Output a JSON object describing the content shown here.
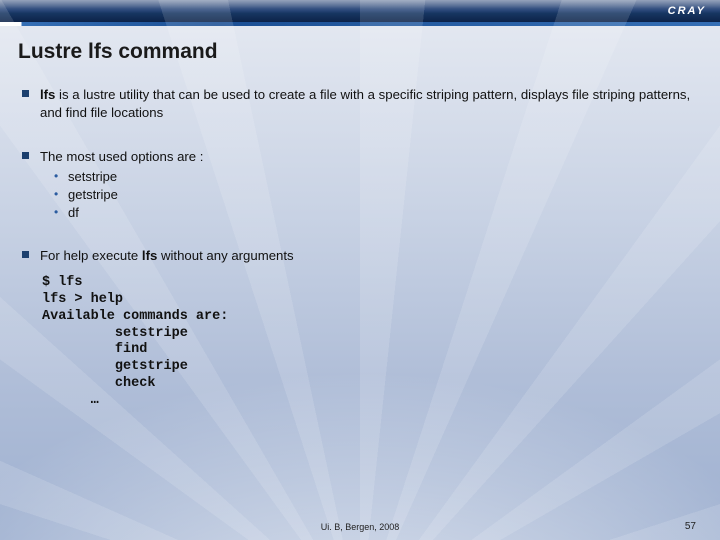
{
  "brand": "CRAY",
  "title": "Lustre lfs command",
  "bullets": {
    "b1_strong": "lfs",
    "b1_rest": " is a lustre utility that can be used to create a file with a specific striping pattern, displays file striping patterns, and find file locations",
    "b2": "The most used options are :",
    "b2_items": [
      "setstripe",
      "getstripe",
      "df"
    ],
    "b3_pre": "For help execute ",
    "b3_strong": "lfs",
    "b3_post": " without any arguments"
  },
  "code_lines": [
    "$ lfs",
    "lfs > help",
    "Available commands are:",
    "         setstripe",
    "         find",
    "         getstripe",
    "         check",
    "      …"
  ],
  "footer": "Ui. B, Bergen, 2008",
  "page": "57"
}
